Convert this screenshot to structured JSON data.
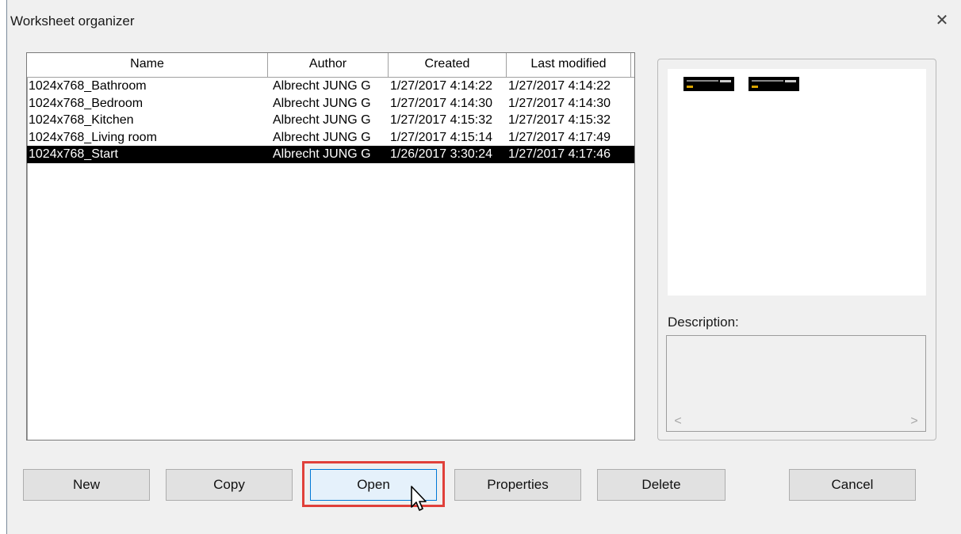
{
  "dialog": {
    "title": "Worksheet organizer",
    "close_glyph": "✕"
  },
  "list": {
    "columns": [
      "Name",
      "Author",
      "Created",
      "Last modified"
    ],
    "rows": [
      {
        "name": "1024x768_Bathroom",
        "author": "Albrecht JUNG G",
        "created": "1/27/2017 4:14:22",
        "modified": "1/27/2017 4:14:22"
      },
      {
        "name": "1024x768_Bedroom",
        "author": "Albrecht JUNG G",
        "created": "1/27/2017 4:14:30",
        "modified": "1/27/2017 4:14:30"
      },
      {
        "name": "1024x768_Kitchen",
        "author": "Albrecht JUNG G",
        "created": "1/27/2017 4:15:32",
        "modified": "1/27/2017 4:15:32"
      },
      {
        "name": "1024x768_Living room",
        "author": "Albrecht JUNG G",
        "created": "1/27/2017 4:15:14",
        "modified": "1/27/2017 4:17:49"
      },
      {
        "name": "1024x768_Start",
        "author": "Albrecht JUNG G",
        "created": "1/26/2017 3:30:24",
        "modified": "1/27/2017 4:17:46"
      }
    ],
    "selected_index": 4
  },
  "preview": {
    "description_label": "Description:",
    "scroll_left_glyph": "<",
    "scroll_right_glyph": ">"
  },
  "buttons": {
    "new": "New",
    "copy": "Copy",
    "open": "Open",
    "properties": "Properties",
    "delete": "Delete",
    "cancel": "Cancel"
  },
  "colors": {
    "highlight": "#e0403a",
    "selection": "#000000"
  }
}
